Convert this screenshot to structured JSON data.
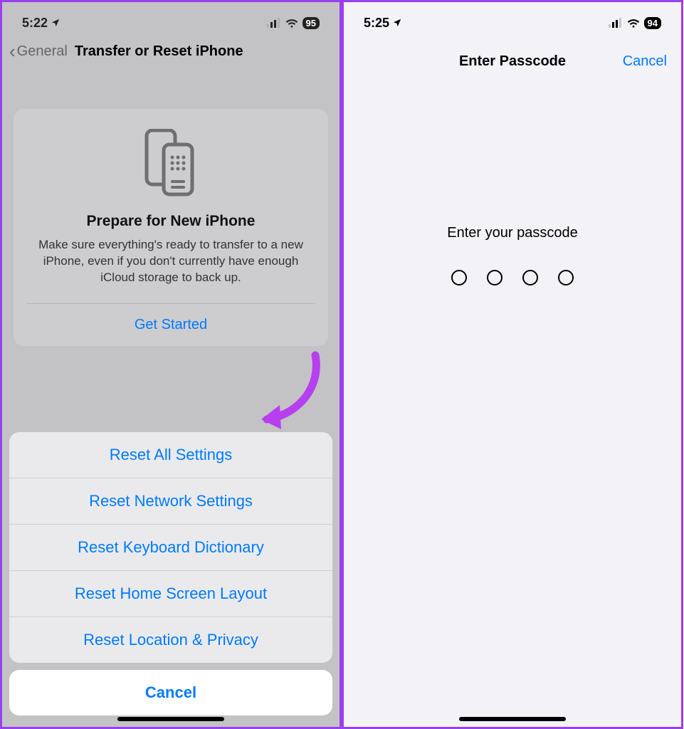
{
  "left": {
    "status": {
      "time": "5:22",
      "battery": "95"
    },
    "nav": {
      "back": "General",
      "title": "Transfer or Reset iPhone"
    },
    "card": {
      "title": "Prepare for New iPhone",
      "body": "Make sure everything's ready to transfer to a new iPhone, even if you don't currently have enough iCloud storage to back up.",
      "action": "Get Started"
    },
    "sheet": {
      "items": [
        "Reset All Settings",
        "Reset Network Settings",
        "Reset Keyboard Dictionary",
        "Reset Home Screen Layout",
        "Reset Location & Privacy"
      ],
      "cancel": "Cancel"
    }
  },
  "right": {
    "status": {
      "time": "5:25",
      "battery": "94"
    },
    "header": {
      "title": "Enter Passcode",
      "cancel": "Cancel"
    },
    "prompt": "Enter your passcode"
  }
}
